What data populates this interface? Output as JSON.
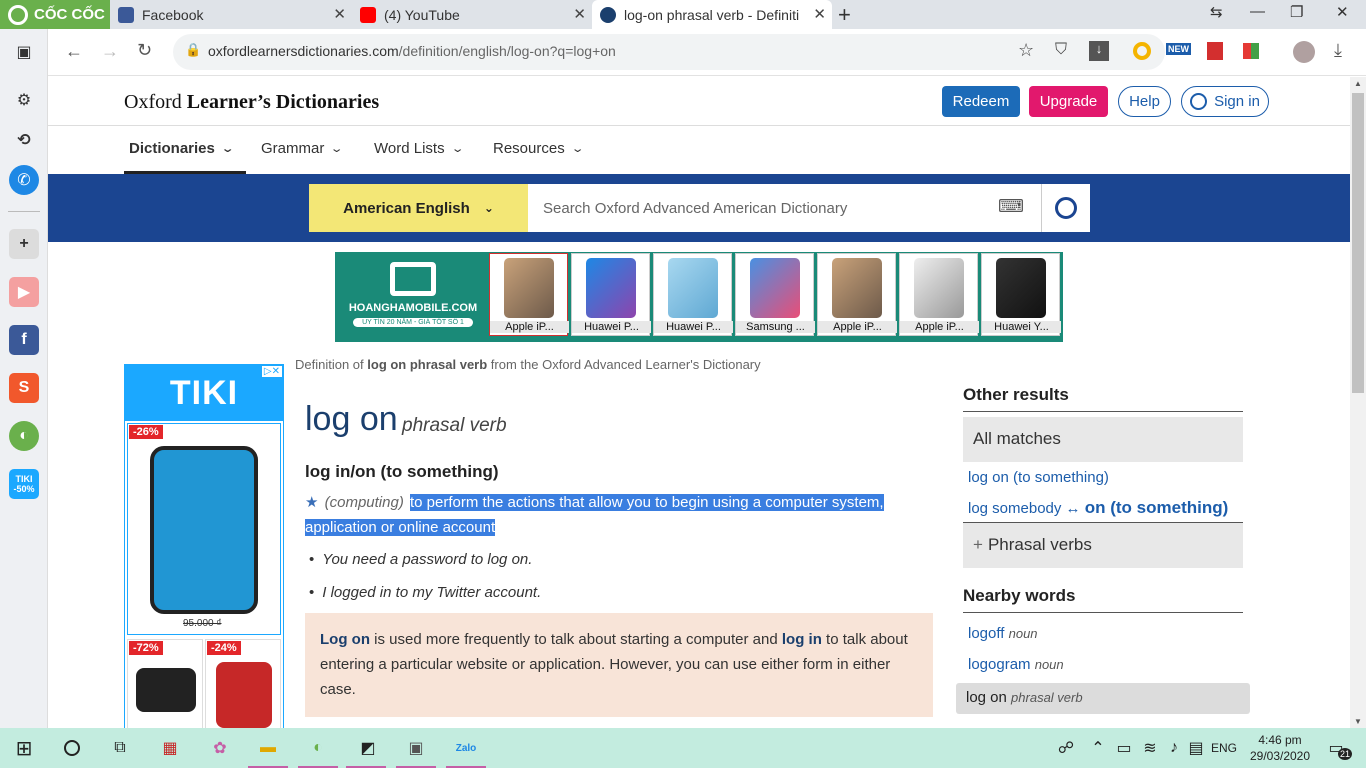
{
  "browser": {
    "brand": "CỐC CỐC",
    "tabs": [
      {
        "title": "Facebook",
        "icon": "facebook-icon"
      },
      {
        "title": "(4) YouTube",
        "icon": "youtube-icon"
      },
      {
        "title": "log-on phrasal verb - Definiti",
        "icon": "oxford-icon"
      }
    ],
    "new_tab": "+",
    "url_host": "oxfordlearnersdictionaries.com",
    "url_path": "/definition/english/log-on?q=log+on"
  },
  "site": {
    "logo_regular": "Oxford ",
    "logo_bold": "Learner’s Dictionaries",
    "redeem": "Redeem",
    "upgrade": "Upgrade",
    "help": "Help",
    "signin": "Sign in",
    "nav": [
      "Dictionaries",
      "Grammar",
      "Word Lists",
      "Resources"
    ],
    "language": "American English",
    "search_placeholder": "Search Oxford Advanced American Dictionary"
  },
  "ad": {
    "brand": "HOANGHAMOBILE.COM",
    "tagline": "UY TÍN 20 NĂM - GIÁ TỐT SỐ 1",
    "products": [
      "Apple iP...",
      "Huawei P...",
      "Huawei P...",
      "Samsung ...",
      "Apple iP...",
      "Apple iP...",
      "Huawei Y..."
    ]
  },
  "tiki": {
    "brand": "TIKI",
    "discounts": [
      "-26%",
      "-72%",
      "-24%"
    ],
    "price": "95.000 ₫"
  },
  "entry": {
    "crumb_pre": "Definition of ",
    "crumb_word": "log on phrasal verb",
    "crumb_post": " from the Oxford Advanced Learner's Dictionary",
    "headword": "log on",
    "pos": "phrasal verb",
    "sense_title": "log in/on (to something)",
    "label": "(computing)",
    "definition": "to perform the actions that allow you to begin using a computer system, application or online account",
    "examples": [
      "You need a password to log on.",
      "I logged in to my Twitter account."
    ],
    "note_bold1": "Log on",
    "note_text1": " is used more frequently to talk about starting a computer and ",
    "note_bold2": "log in",
    "note_text2": " to talk about entering a particular website or application. However, you can use either form in either case."
  },
  "sidebar_right": {
    "other_results": "Other results",
    "all_matches": "All matches",
    "link1": "log on (to something)",
    "link2_pre": "log somebody ↔ ",
    "link2_bold": "on (to something)",
    "phrasal_verbs": "Phrasal verbs",
    "nearby": "Nearby words",
    "nearby_words": [
      {
        "word": "logoff",
        "pos": "noun"
      },
      {
        "word": "logogram",
        "pos": "noun"
      },
      {
        "word": "log on",
        "pos": "phrasal verb"
      }
    ]
  },
  "taskbar": {
    "lang": "ENG",
    "time": "4:46 pm",
    "date": "29/03/2020",
    "notifications": "21"
  }
}
